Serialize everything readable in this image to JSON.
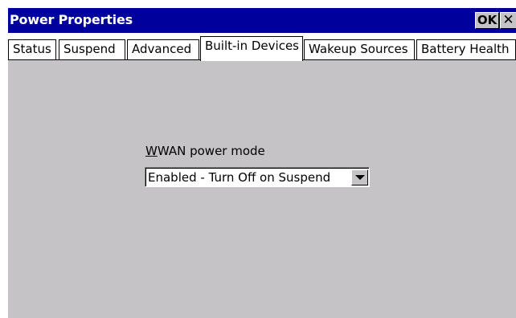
{
  "window": {
    "title": "Power Properties",
    "ok_label": "OK",
    "close_glyph": "✕"
  },
  "tabs": [
    {
      "label": "Status",
      "active": false
    },
    {
      "label": "Suspend",
      "active": false
    },
    {
      "label": "Advanced",
      "active": false
    },
    {
      "label": "Built-in Devices",
      "active": true
    },
    {
      "label": "Wakeup Sources",
      "active": false
    },
    {
      "label": "Battery Health",
      "active": false
    }
  ],
  "panel": {
    "wwan_label_first": "W",
    "wwan_label_rest": "WAN power mode",
    "wwan_mode_value": "Enabled - Turn Off on Suspend"
  },
  "colors": {
    "titlebar": "#00009c",
    "panel_bg": "#c6c3c6"
  },
  "icons": {
    "dropdown": "chevron-down-icon",
    "close": "close-icon"
  }
}
